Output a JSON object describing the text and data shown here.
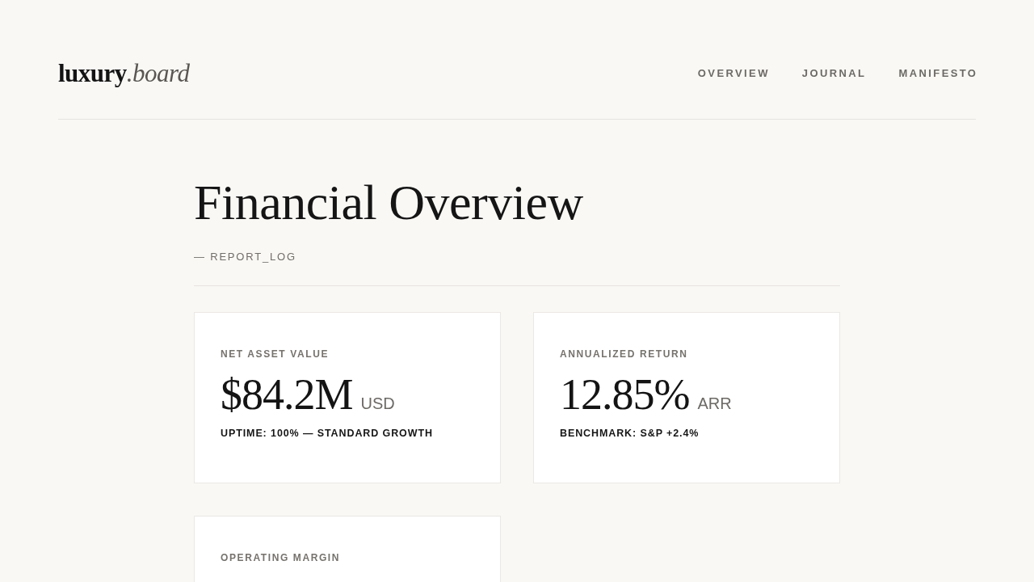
{
  "header": {
    "logo": {
      "name": "luxury",
      "suffix": ".board"
    },
    "nav": [
      {
        "label": "OVERVIEW"
      },
      {
        "label": "JOURNAL"
      },
      {
        "label": "MANIFESTO"
      }
    ]
  },
  "page": {
    "title": "Financial Overview",
    "subtitle": "— REPORT_LOG"
  },
  "cards": [
    {
      "label": "NET ASSET VALUE",
      "value": "$84.2M",
      "unit": "USD",
      "note": "UPTIME: 100% — STANDARD GROWTH"
    },
    {
      "label": "ANNUALIZED RETURN",
      "value": "12.85%",
      "unit": "ARR",
      "note": "BENCHMARK: S&P +2.4%"
    },
    {
      "label": "OPERATING MARGIN"
    }
  ]
}
